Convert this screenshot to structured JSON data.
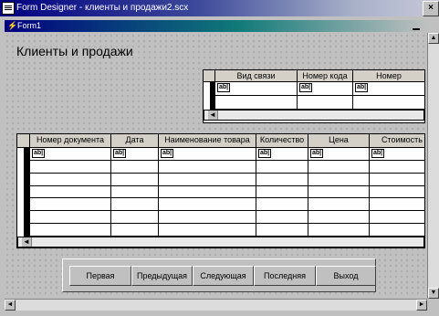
{
  "window": {
    "title": "Form Designer - клиенты и продажи2.scx",
    "close_glyph": "×"
  },
  "form": {
    "title": "Form1",
    "caption": "Клиенты и продажи"
  },
  "grid_top": {
    "columns": [
      "Вид связи",
      "Номер кода",
      "Номер"
    ],
    "textbox_label": "ab|",
    "rows": 2
  },
  "grid_bottom": {
    "columns": [
      "Номер документа",
      "Дата",
      "Наименование товара",
      "Количество",
      "Цена",
      "Стоимость"
    ],
    "textbox_label": "ab|",
    "rows": 7
  },
  "buttons": {
    "first": "Первая",
    "prev": "Предыдущая",
    "next": "Следующая",
    "last": "Последняя",
    "exit": "Выход"
  },
  "scroll": {
    "left": "◄",
    "right": "►",
    "up": "▲",
    "down": "▼"
  },
  "icons": {
    "window": "form-designer-icon",
    "form": "form-icon"
  }
}
